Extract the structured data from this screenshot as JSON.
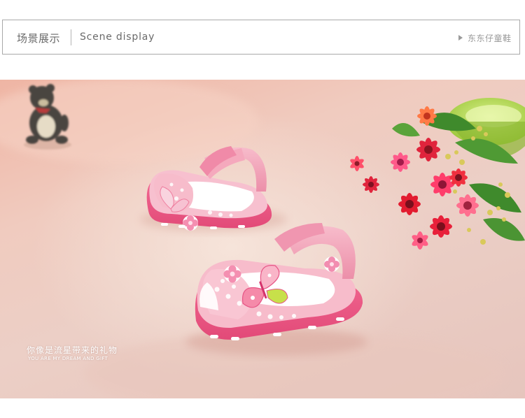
{
  "header": {
    "title_cn": "场景展示",
    "title_en": "Scene display",
    "brand": "东东仔童鞋",
    "arrow_icon": "triangle-right-icon"
  },
  "photo": {
    "caption_cn": "你像是流星带来的礼物",
    "caption_en": "YOU ARE MY DREAM AND GIFT",
    "subjects": [
      "pink-sandals-pair",
      "teddy-bear-figurine",
      "flower-pot"
    ]
  },
  "colors": {
    "header_border": "#a9a9a9",
    "header_text": "#6a6a6a",
    "sandal_pink": "#f2a8bd",
    "sole_pink": "#ef5f8a",
    "background_tone": "#eccfc6"
  }
}
